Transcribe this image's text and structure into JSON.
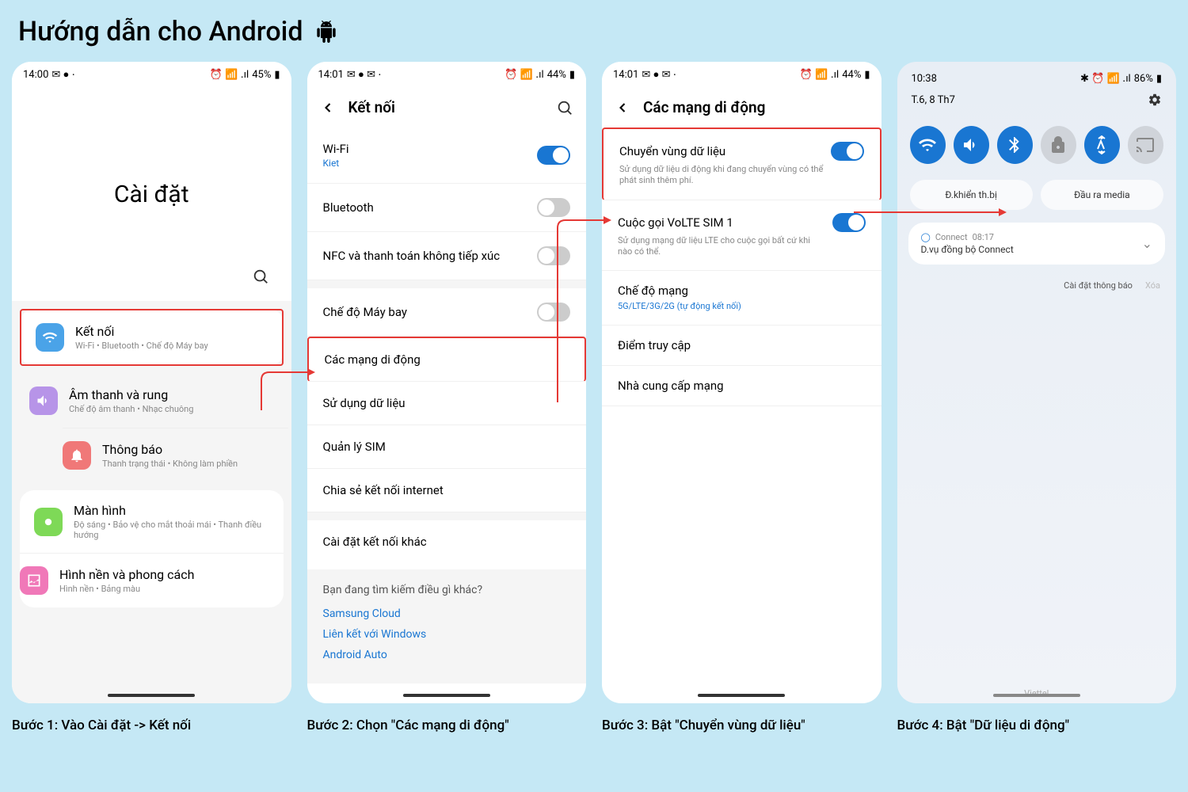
{
  "page_title": "Hướng dẫn cho Android",
  "captions": [
    "Bước 1: Vào Cài đặt -> Kết nối",
    "Bước 2: Chọn \"Các mạng di động\"",
    "Bước 3: Bật \"Chuyển vùng dữ liệu\"",
    "Bước 4: Bật \"Dữ liệu di động\""
  ],
  "s1": {
    "time": "14:00",
    "battery": "45%",
    "title": "Cài đặt",
    "items": [
      {
        "title": "Kết nối",
        "sub": "Wi-Fi  •  Bluetooth  •  Chế độ Máy bay",
        "color": "#4aa3e8",
        "hl": true
      },
      {
        "title": "Âm thanh và rung",
        "sub": "Chế độ âm thanh  •  Nhạc chuông",
        "color": "#b794e8"
      },
      {
        "title": "Thông báo",
        "sub": "Thanh trạng thái  •  Không làm phiền",
        "color": "#f07878"
      },
      {
        "title": "Màn hình",
        "sub": "Độ sáng  •  Bảo vệ cho mắt thoải mái  •  Thanh điều hướng",
        "color": "#7ed957"
      },
      {
        "title": "Hình nền và phong cách",
        "sub": "Hình nền  •  Bảng màu",
        "color": "#f078b8"
      }
    ]
  },
  "s2": {
    "time": "14:01",
    "battery": "44%",
    "title": "Kết nối",
    "items": [
      {
        "title": "Wi-Fi",
        "sub": "Kiet",
        "toggle": true,
        "on": true
      },
      {
        "title": "Bluetooth",
        "toggle": true,
        "on": false
      },
      {
        "title": "NFC và thanh toán không tiếp xúc",
        "toggle": true,
        "on": false
      },
      {
        "title": "Chế độ Máy bay",
        "toggle": true,
        "on": false,
        "gap": true
      },
      {
        "title": "Các mạng di động",
        "hl": true
      },
      {
        "title": "Sử dụng dữ liệu"
      },
      {
        "title": "Quản lý SIM"
      },
      {
        "title": "Chia sẻ kết nối internet"
      },
      {
        "title": "Cài đặt kết nối khác",
        "gap": true
      }
    ],
    "footer_q": "Bạn đang tìm kiếm điều gì khác?",
    "footer_links": [
      "Samsung Cloud",
      "Liên kết với Windows",
      "Android Auto"
    ]
  },
  "s3": {
    "time": "14:01",
    "battery": "44%",
    "title": "Các mạng di động",
    "items": [
      {
        "title": "Chuyển vùng dữ liệu",
        "sub": "Sử dụng dữ liệu di động khi đang chuyển vùng có thể phát sinh thêm phí.",
        "toggle": true,
        "on": true,
        "hl": true
      },
      {
        "title": "Cuộc gọi VoLTE SIM 1",
        "sub": "Sử dụng mạng dữ liệu LTE cho cuộc gọi bất cứ khi nào có thể.",
        "toggle": true,
        "on": true
      },
      {
        "title": "Chế độ mạng",
        "sub": "5G/LTE/3G/2G (tự động kết nối)",
        "blue": true
      },
      {
        "title": "Điểm truy cập"
      },
      {
        "title": "Nhà cung cấp mạng"
      }
    ]
  },
  "s4": {
    "time": "10:38",
    "battery": "86%",
    "date": "T.6, 8 Th7",
    "qs": [
      {
        "name": "wifi",
        "on": true
      },
      {
        "name": "sound",
        "on": true
      },
      {
        "name": "bluetooth",
        "on": true
      },
      {
        "name": "lock",
        "on": false
      },
      {
        "name": "data",
        "on": true,
        "hl": true
      },
      {
        "name": "cast",
        "on": false
      }
    ],
    "btn1": "Đ.khiển th.bị",
    "btn2": "Đầu ra media",
    "notif_app": "Connect",
    "notif_time": "08:17",
    "notif_text": "D.vụ đồng bộ Connect",
    "settings_link": "Cài đặt thông báo",
    "clear": "Xóa",
    "carrier": "Viettel"
  }
}
